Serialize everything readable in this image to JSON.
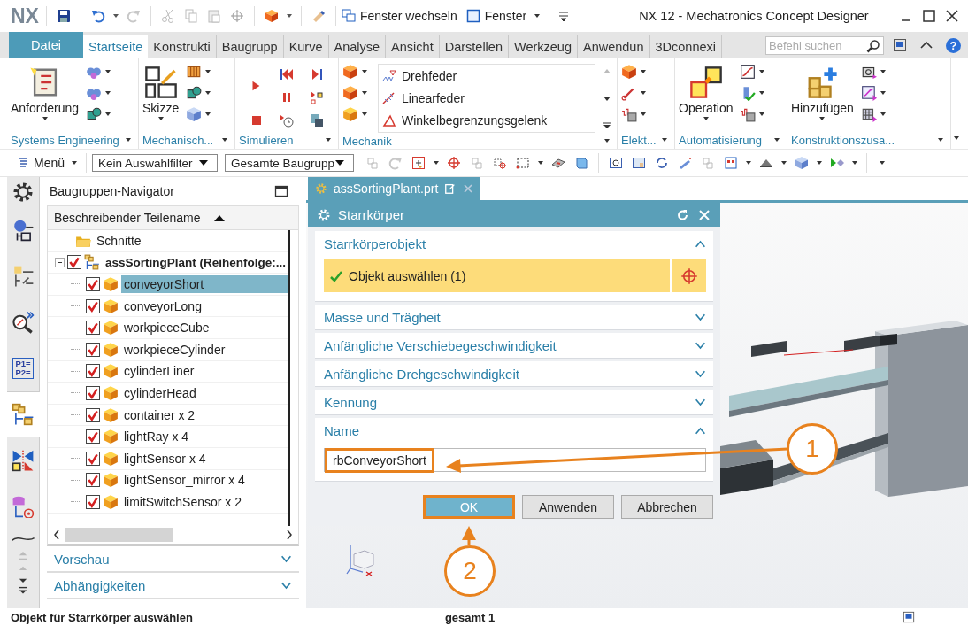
{
  "title_bar": {
    "logo": "NX",
    "window_switch": "Fenster wechseln",
    "window_menu": "Fenster",
    "title": "NX 12 - Mechatronics Concept Designer"
  },
  "ribbon_tabs": [
    {
      "label": "Datei",
      "kind": "file",
      "selected": false
    },
    {
      "label": "Startseite",
      "kind": "tab",
      "selected": true
    },
    {
      "label": "Konstrukti",
      "kind": "tab",
      "selected": false
    },
    {
      "label": "Baugrupp",
      "kind": "tab",
      "selected": false
    },
    {
      "label": "Kurve",
      "kind": "tab",
      "selected": false
    },
    {
      "label": "Analyse",
      "kind": "tab",
      "selected": false
    },
    {
      "label": "Ansicht",
      "kind": "tab",
      "selected": false
    },
    {
      "label": "Darstellen",
      "kind": "tab",
      "selected": false
    },
    {
      "label": "Werkzeug",
      "kind": "tab",
      "selected": false
    },
    {
      "label": "Anwendun",
      "kind": "tab",
      "selected": false
    },
    {
      "label": "3Dconnexi",
      "kind": "tab",
      "selected": false
    }
  ],
  "command_search": {
    "placeholder": "Befehl suchen"
  },
  "help": "?",
  "ribbon_groups": [
    {
      "label": "Systems Engineering",
      "kind": "large",
      "button": "Anforderung"
    },
    {
      "label": "Mechanisch...",
      "kind": "large",
      "button": "Skizze"
    },
    {
      "label": "Simulieren",
      "kind": "simulation"
    },
    {
      "label": "Mechanik",
      "kind": "list",
      "items": [
        "Drehfeder",
        "Linearfeder",
        "Winkelbegrenzungsgelenk"
      ]
    },
    {
      "label": "Elekt...",
      "kind": "small"
    },
    {
      "label": "Automatisierung",
      "kind": "large",
      "button": "Operation"
    },
    {
      "label": "Konstruktionszusa...",
      "kind": "large",
      "button": "Hinzufügen"
    }
  ],
  "toolbar": {
    "menu": "Menü",
    "selection_filter": "Kein Auswahlfilter",
    "scope": "Gesamte Baugrupp"
  },
  "resource_bar": [
    {
      "kind": "settings",
      "selected": false
    },
    {
      "kind": "systems",
      "selected": false
    },
    {
      "kind": "constraints",
      "selected": false
    },
    {
      "kind": "analysis",
      "selected": false
    },
    {
      "kind": "expressions",
      "lines": [
        "P1=",
        "P2="
      ],
      "selected": false
    },
    {
      "kind": "assembly",
      "selected": true
    },
    {
      "kind": "mirror",
      "selected": false
    },
    {
      "kind": "database",
      "selected": false
    }
  ],
  "navigator": {
    "title": "Baugruppen-Navigator",
    "column": "Beschreibender Teilename",
    "tree": [
      {
        "label": "Schnitte",
        "kind": "folder"
      },
      {
        "label": "assSortingPlant (Reihenfolge:...",
        "kind": "assembly",
        "checked": true,
        "expanded": true,
        "children": [
          {
            "label": "conveyorShort",
            "checked": true,
            "selected": true
          },
          {
            "label": "conveyorLong",
            "checked": true,
            "selected": false
          },
          {
            "label": "workpieceCube",
            "checked": true,
            "selected": false
          },
          {
            "label": "workpieceCylinder",
            "checked": true,
            "selected": false
          },
          {
            "label": "cylinderLiner",
            "checked": true,
            "selected": false
          },
          {
            "label": "cylinderHead",
            "checked": true,
            "selected": false
          },
          {
            "label": "container x 2",
            "checked": true,
            "selected": false
          },
          {
            "label": "lightRay x 4",
            "checked": true,
            "selected": false
          },
          {
            "label": "lightSensor x 4",
            "checked": true,
            "selected": false
          },
          {
            "label": "lightSensor_mirror x 4",
            "checked": true,
            "selected": false
          },
          {
            "label": "limitSwitchSensor x 2",
            "checked": true,
            "selected": false
          }
        ]
      }
    ],
    "panels": [
      {
        "label": "Vorschau",
        "expanded": false
      },
      {
        "label": "Abhängigkeiten",
        "expanded": false
      }
    ]
  },
  "document_tab": {
    "label": "assSortingPlant.prt"
  },
  "dialog": {
    "title": "Starrkörper",
    "sections": [
      {
        "label": "Starrkörperobjekt",
        "kind": "selection",
        "expanded": true,
        "selection": "Objekt auswählen (1)"
      },
      {
        "label": "Masse und Trägheit",
        "expanded": false
      },
      {
        "label": "Anfängliche Verschiebegeschwindigkeit",
        "expanded": false
      },
      {
        "label": "Anfängliche Drehgeschwindigkeit",
        "expanded": false
      },
      {
        "label": "Kennung",
        "expanded": false
      },
      {
        "label": "Name",
        "kind": "name",
        "expanded": true,
        "value": "rbConveyorShort",
        "highlighted": true
      }
    ],
    "buttons": [
      {
        "label": "OK",
        "kind": "primary",
        "highlighted": true
      },
      {
        "label": "Anwenden",
        "kind": "normal",
        "highlighted": false
      },
      {
        "label": "Abbrechen",
        "kind": "normal",
        "highlighted": false
      }
    ]
  },
  "callouts": [
    {
      "number": "1"
    },
    {
      "number": "2"
    }
  ],
  "status_bar": {
    "message": "Objekt für Starrkörper auswählen",
    "count": "gesamt 1"
  }
}
